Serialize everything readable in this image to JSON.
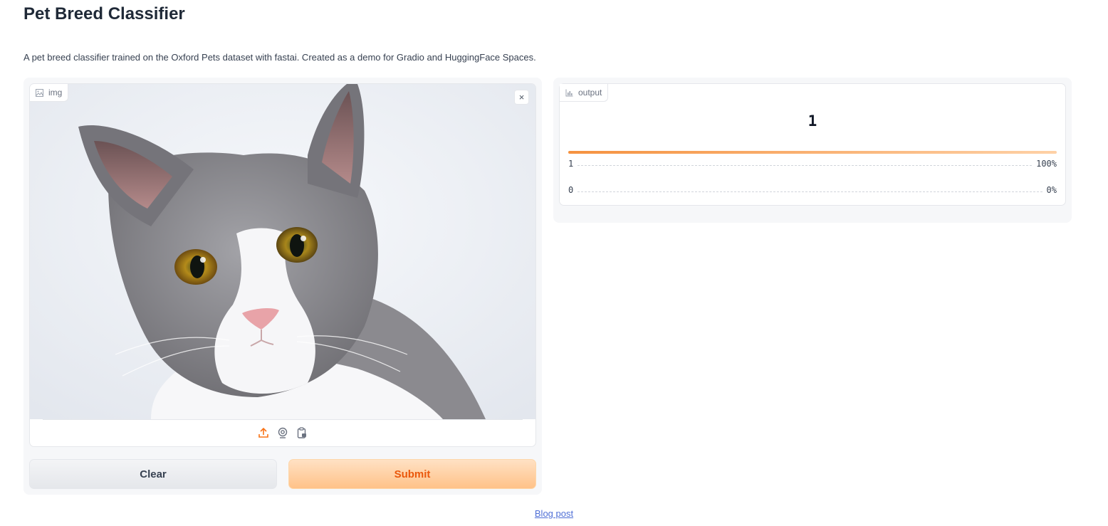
{
  "page": {
    "title": "Pet Breed Classifier",
    "description": "A pet breed classifier trained on the Oxford Pets dataset with fastai. Created as a demo for Gradio and HuggingFace Spaces."
  },
  "input": {
    "label": "img",
    "label_icon": "image-icon",
    "clear_image_symbol": "×",
    "sources": [
      "upload-icon",
      "webcam-icon",
      "clipboard-icon"
    ]
  },
  "buttons": {
    "clear": "Clear",
    "submit": "Submit"
  },
  "output": {
    "label": "output",
    "label_icon": "bar-chart-icon",
    "top_label": "1",
    "confidences": [
      {
        "label": "1",
        "value": "100%",
        "fraction": 1.0
      },
      {
        "label": "0",
        "value": "0%",
        "fraction": 0.0
      }
    ]
  },
  "footer": {
    "link_text": "Blog post"
  },
  "colors": {
    "accent": "#f97316",
    "submit_text": "#ea580c",
    "link": "#4f6fd6"
  }
}
